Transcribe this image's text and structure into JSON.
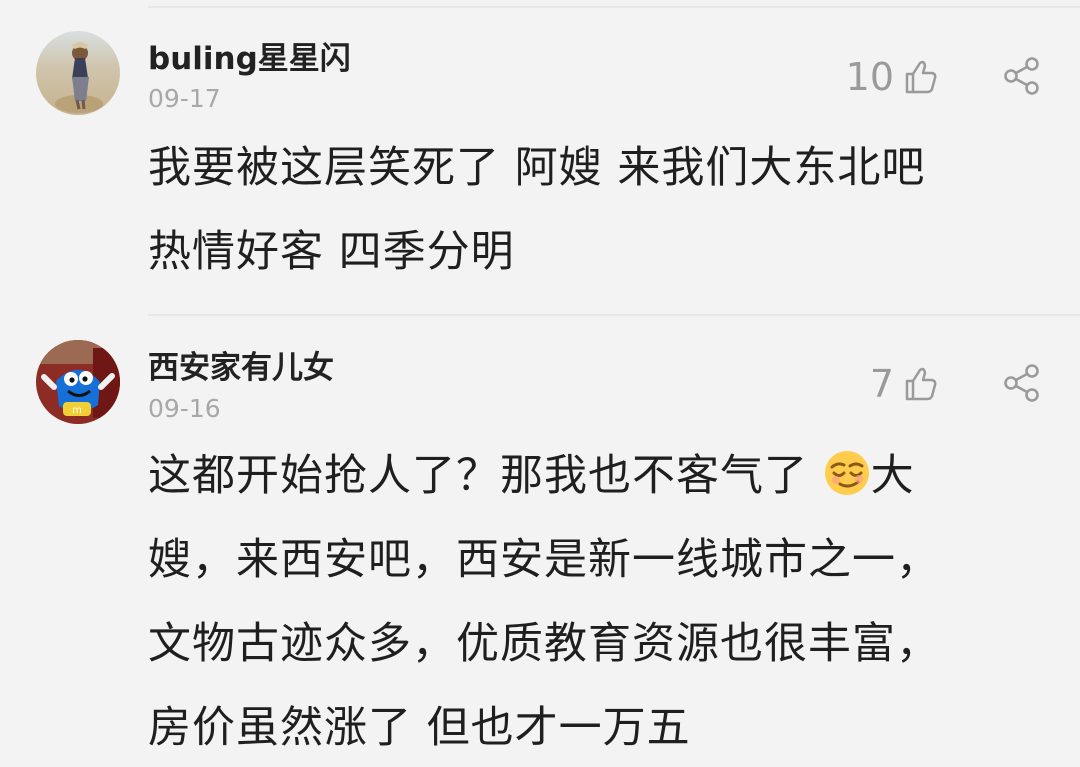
{
  "comments": [
    {
      "username": "buling星星闪",
      "date": "09-17",
      "likes": "10",
      "text_lines": [
        "我要被这层笑死了 阿嫂 来我们大东北吧",
        "热情好客 四季分明"
      ]
    },
    {
      "username": "西安家有儿女",
      "date": "09-16",
      "likes": "7",
      "text_lines": [
        "这都开始抢人了？那我也不客气了",
        "大",
        "嫂，来西安吧，西安是新一线城市之一，",
        "文物古迹众多，优质教育资源也很丰富，",
        "房价虽然涨了 但也才一万五"
      ]
    }
  ],
  "icons": {
    "thumb": "thumb-up-icon",
    "share": "share-icon",
    "emoji": "smirk-emoji"
  }
}
